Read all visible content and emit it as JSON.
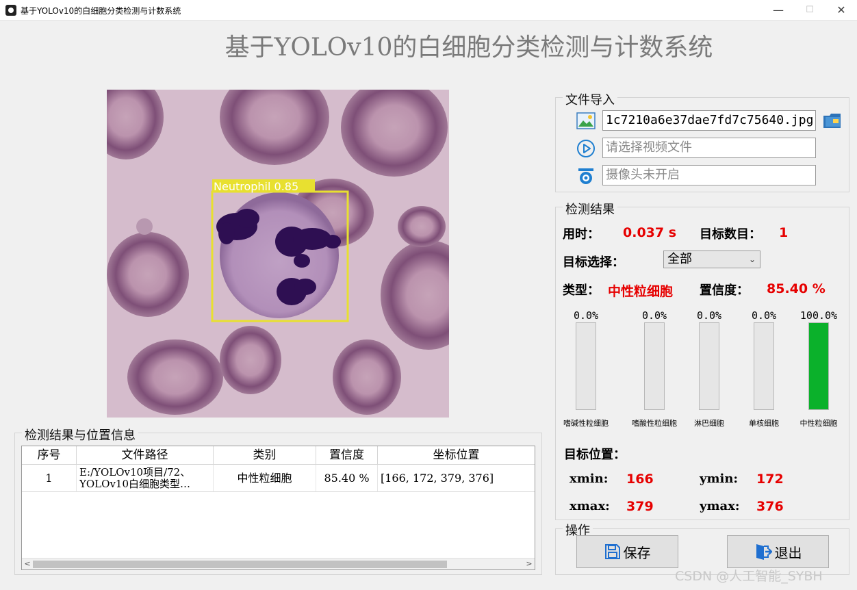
{
  "window": {
    "title": "基于YOLOv10的白细胞分类检测与计数系统",
    "minimize": "—",
    "maximize": "☐",
    "close": "✕"
  },
  "header": {
    "title": "基于YOLOv10的白细胞分类检测与计数系统"
  },
  "image": {
    "detection_label": "Neutrophil 0.85"
  },
  "file_import": {
    "legend": "文件导入",
    "image_path": "1c7210a6e37dae7fd7c75640.jpg",
    "video_placeholder": "请选择视频文件",
    "camera_placeholder": "摄像头未开启"
  },
  "results": {
    "legend": "检测结果",
    "time_label": "用时：",
    "time_value": "0.037 s",
    "count_label": "目标数目：",
    "count_value": "1",
    "select_label": "目标选择：",
    "select_value": "全部",
    "type_label": "类型：",
    "type_value": "中性粒细胞",
    "conf_label": "置信度：",
    "conf_value": "85.40 %",
    "bars": [
      {
        "name": "嗜碱性粒细胞",
        "pct": "0.0%",
        "fraction": 0.0
      },
      {
        "name": "嗜酸性粒细胞",
        "pct": "0.0%",
        "fraction": 0.0
      },
      {
        "name": "淋巴细胞",
        "pct": "0.0%",
        "fraction": 0.0
      },
      {
        "name": "单核细胞",
        "pct": "0.0%",
        "fraction": 0.0
      },
      {
        "name": "中性粒细胞",
        "pct": "100.0%",
        "fraction": 1.0
      }
    ],
    "position_label": "目标位置：",
    "xmin_label": "xmin:",
    "xmin_value": "166",
    "ymin_label": "ymin:",
    "ymin_value": "172",
    "xmax_label": "xmax:",
    "xmax_value": "379",
    "ymax_label": "ymax:",
    "ymax_value": "376"
  },
  "operations": {
    "legend": "操作",
    "save_label": "保存",
    "exit_label": "退出"
  },
  "table": {
    "legend": "检测结果与位置信息",
    "headers": [
      "序号",
      "文件路径",
      "类别",
      "置信度",
      "坐标位置"
    ],
    "rows": [
      {
        "index": "1",
        "path_line1": "E:/YOLOv10项目/72、",
        "path_line2": "YOLOv10白细胞类型…",
        "category": "中性粒细胞",
        "confidence": "85.40 %",
        "coords": "[166, 172, 379, 376]"
      }
    ],
    "scroll_left": "<",
    "scroll_right": ">"
  },
  "watermark": "CSDN @人工智能_SYBH",
  "colors": {
    "accent_red": "#e60000",
    "bar_green": "#0bb12b",
    "detect_box": "#e8e030"
  }
}
